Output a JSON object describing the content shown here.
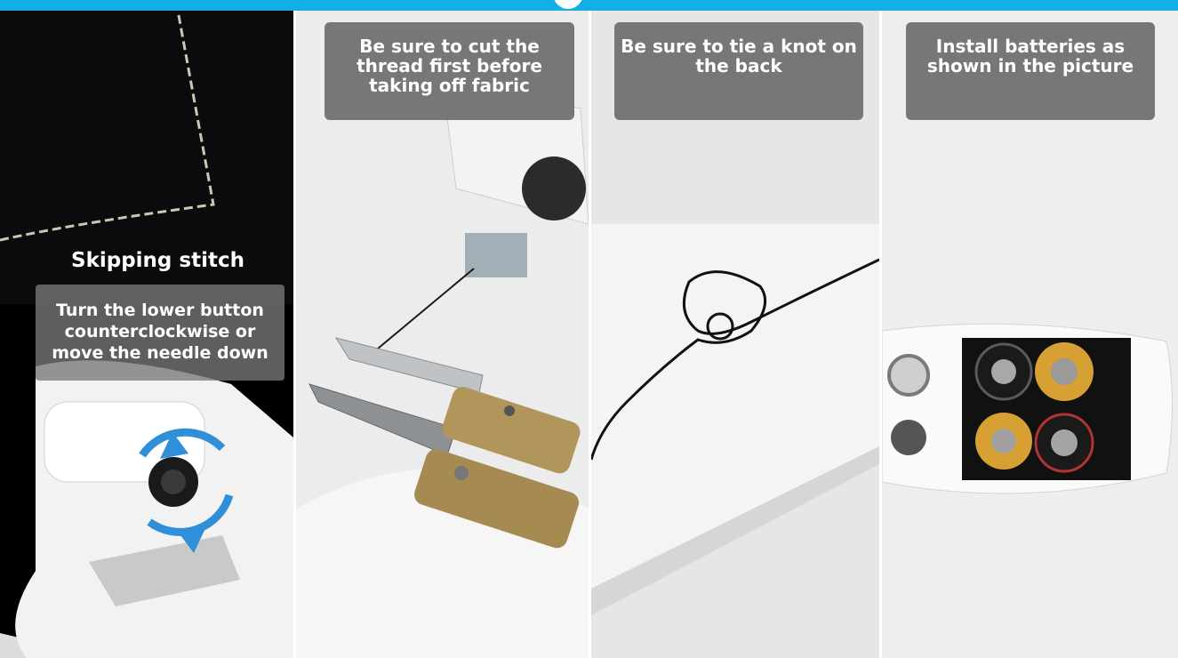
{
  "panels": [
    {
      "label": "Skipping stitch",
      "instruction_lines": [
        "Turn the lower button",
        "counterclockwise or",
        "move the needle down"
      ]
    },
    {
      "caption_lines": [
        "Be sure to cut the",
        "thread first before",
        "taking off fabric"
      ]
    },
    {
      "caption_lines": [
        "Be sure to tie a knot on",
        "the back"
      ]
    },
    {
      "caption_lines": [
        "Install batteries as",
        "shown in the picture"
      ]
    }
  ],
  "colors": {
    "accent": "#12aee6",
    "caption_bg": "#6e6e6e",
    "rotate_arrow": "#2f8fd8"
  }
}
